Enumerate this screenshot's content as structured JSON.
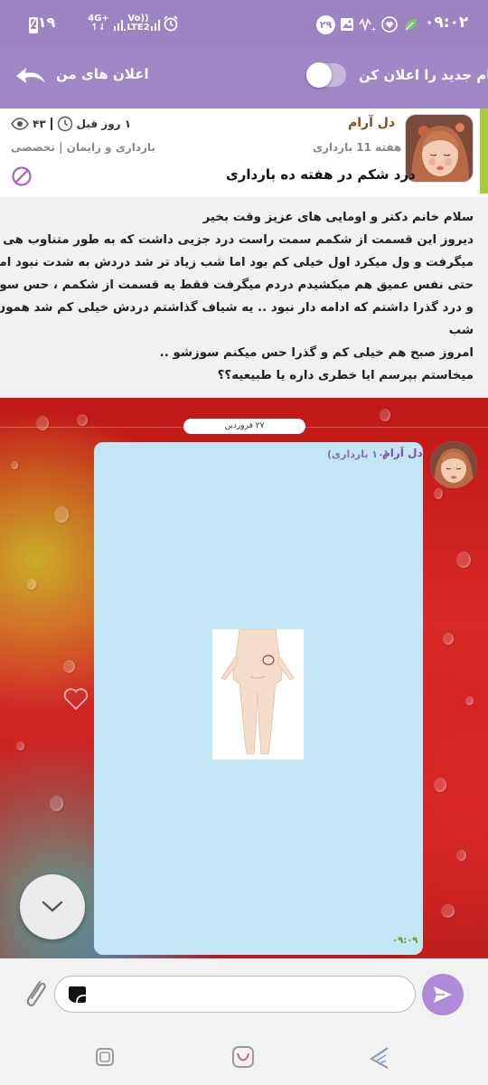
{
  "status_bar": {
    "time": "۰۹:۰۲",
    "badge_count": "۲۹",
    "battery": "٪۱۹",
    "network_top": "4G+",
    "network_bottom": "↿⇃",
    "volte_top": "Vo))",
    "volte_bottom": "LTE2"
  },
  "top_bar": {
    "title": "اعلان های من",
    "toggle_label": "پیام جدید را اعلان کن",
    "toggle_on": false
  },
  "post": {
    "author": "دل آرام",
    "week": "هفته 11 بارداری",
    "title": "درد شکم در هفته ده بارداری",
    "time_ago": "۱ روز قبل",
    "views": "۴۳",
    "category": "بارداری و زایمان | تخصصی",
    "body_lines": [
      "سلام خانم دکتر و اومایی های عزیز وقت بخیر",
      "دیروز این قسمت از شکمم سمت راست درد جزیی داشت که به طور متناوب هی",
      "میگرفت و ول میکرد اول خیلی کم بود اما شب زیاد تر شد دردش به شدت نبود اما",
      "حتی نفس عمیق هم میکشیدم دردم میگرفت فقط یه قسمت از شکمم ، حس سوزش",
      "و درد گذرا داشتم که ادامه دار نبود .. یه شیاف گذاشتم دردش خیلی کم شد همون",
      "شب",
      "امروز صبح هم خیلی کم و گذرا حس میکنم سوزشو ..",
      "میخاستم بپرسم ایا خطری داره یا طبیعیه؟؟"
    ]
  },
  "chat": {
    "date": "۲۷ فروردین",
    "message": {
      "sender": "دل آرام",
      "sender_note": "(۱۰ بارداری)",
      "time": "۰۹:۰۹"
    }
  },
  "input": {
    "placeholder": ""
  },
  "colors": {
    "status_bar": "#9c84c2",
    "top_bar": "#a088c6",
    "accent_green": "#a6cc3c",
    "author": "#8a4a10",
    "bubble": "#c3e6f5",
    "send": "#b08ad8"
  }
}
